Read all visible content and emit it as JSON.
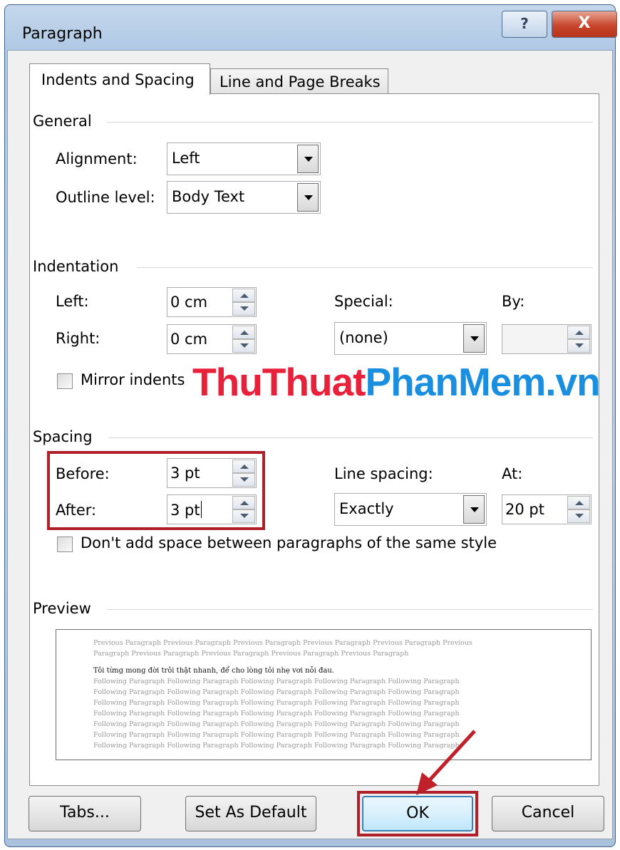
{
  "window": {
    "title": "Paragraph",
    "help_glyph": "?",
    "close_glyph": "X"
  },
  "tabs": [
    {
      "label": "Indents and Spacing",
      "active": true
    },
    {
      "label": "Line and Page Breaks",
      "active": false
    }
  ],
  "general": {
    "heading": "General",
    "alignment": {
      "label": "Alignment:",
      "value": "Left"
    },
    "outline_level": {
      "label": "Outline level:",
      "value": "Body Text"
    }
  },
  "indentation": {
    "heading": "Indentation",
    "left": {
      "label": "Left:",
      "value": "0 cm"
    },
    "right": {
      "label": "Right:",
      "value": "0 cm"
    },
    "special": {
      "label": "Special:",
      "value": "(none)"
    },
    "by": {
      "label": "By:",
      "value": ""
    },
    "mirror_indents": {
      "label": "Mirror indents",
      "checked": false
    }
  },
  "watermark": {
    "part1": "ThuThuat",
    "part2": "PhanMem.vn"
  },
  "spacing": {
    "heading": "Spacing",
    "before": {
      "label": "Before:",
      "value": "3 pt"
    },
    "after": {
      "label": "After:",
      "value": "3 pt"
    },
    "line_spacing": {
      "label": "Line spacing:",
      "value": "Exactly"
    },
    "at": {
      "label": "At:",
      "value": "20 pt"
    },
    "dont_add_space": {
      "label": "Don't add space between paragraphs of the same style",
      "checked": false
    }
  },
  "preview": {
    "heading": "Preview",
    "previous_lines": [
      "Previous Paragraph Previous Paragraph Previous Paragraph Previous Paragraph Previous Paragraph Previous",
      "Paragraph Previous Paragraph Previous Paragraph Previous Paragraph Previous Paragraph"
    ],
    "sample_line": "Tôi từng mong đời trôi thật nhanh, để cho lòng tôi nhẹ vơi nỗi đau.",
    "following_lines": [
      "Following Paragraph Following Paragraph Following Paragraph Following Paragraph Following Paragraph",
      "Following Paragraph Following Paragraph Following Paragraph Following Paragraph Following Paragraph",
      "Following Paragraph Following Paragraph Following Paragraph Following Paragraph Following Paragraph",
      "Following Paragraph Following Paragraph Following Paragraph Following Paragraph Following Paragraph",
      "Following Paragraph Following Paragraph Following Paragraph Following Paragraph Following Paragraph",
      "Following Paragraph Following Paragraph Following Paragraph Following Paragraph Following Paragraph",
      "Following Paragraph Following Paragraph Following Paragraph Following Paragraph Following Paragraph"
    ]
  },
  "buttons": {
    "tabs": "Tabs...",
    "set_default": "Set As Default",
    "ok": "OK",
    "cancel": "Cancel"
  },
  "colors": {
    "highlight": "#b0202a",
    "watermark_red": "#e8203a",
    "watermark_blue": "#1a8fe0"
  }
}
